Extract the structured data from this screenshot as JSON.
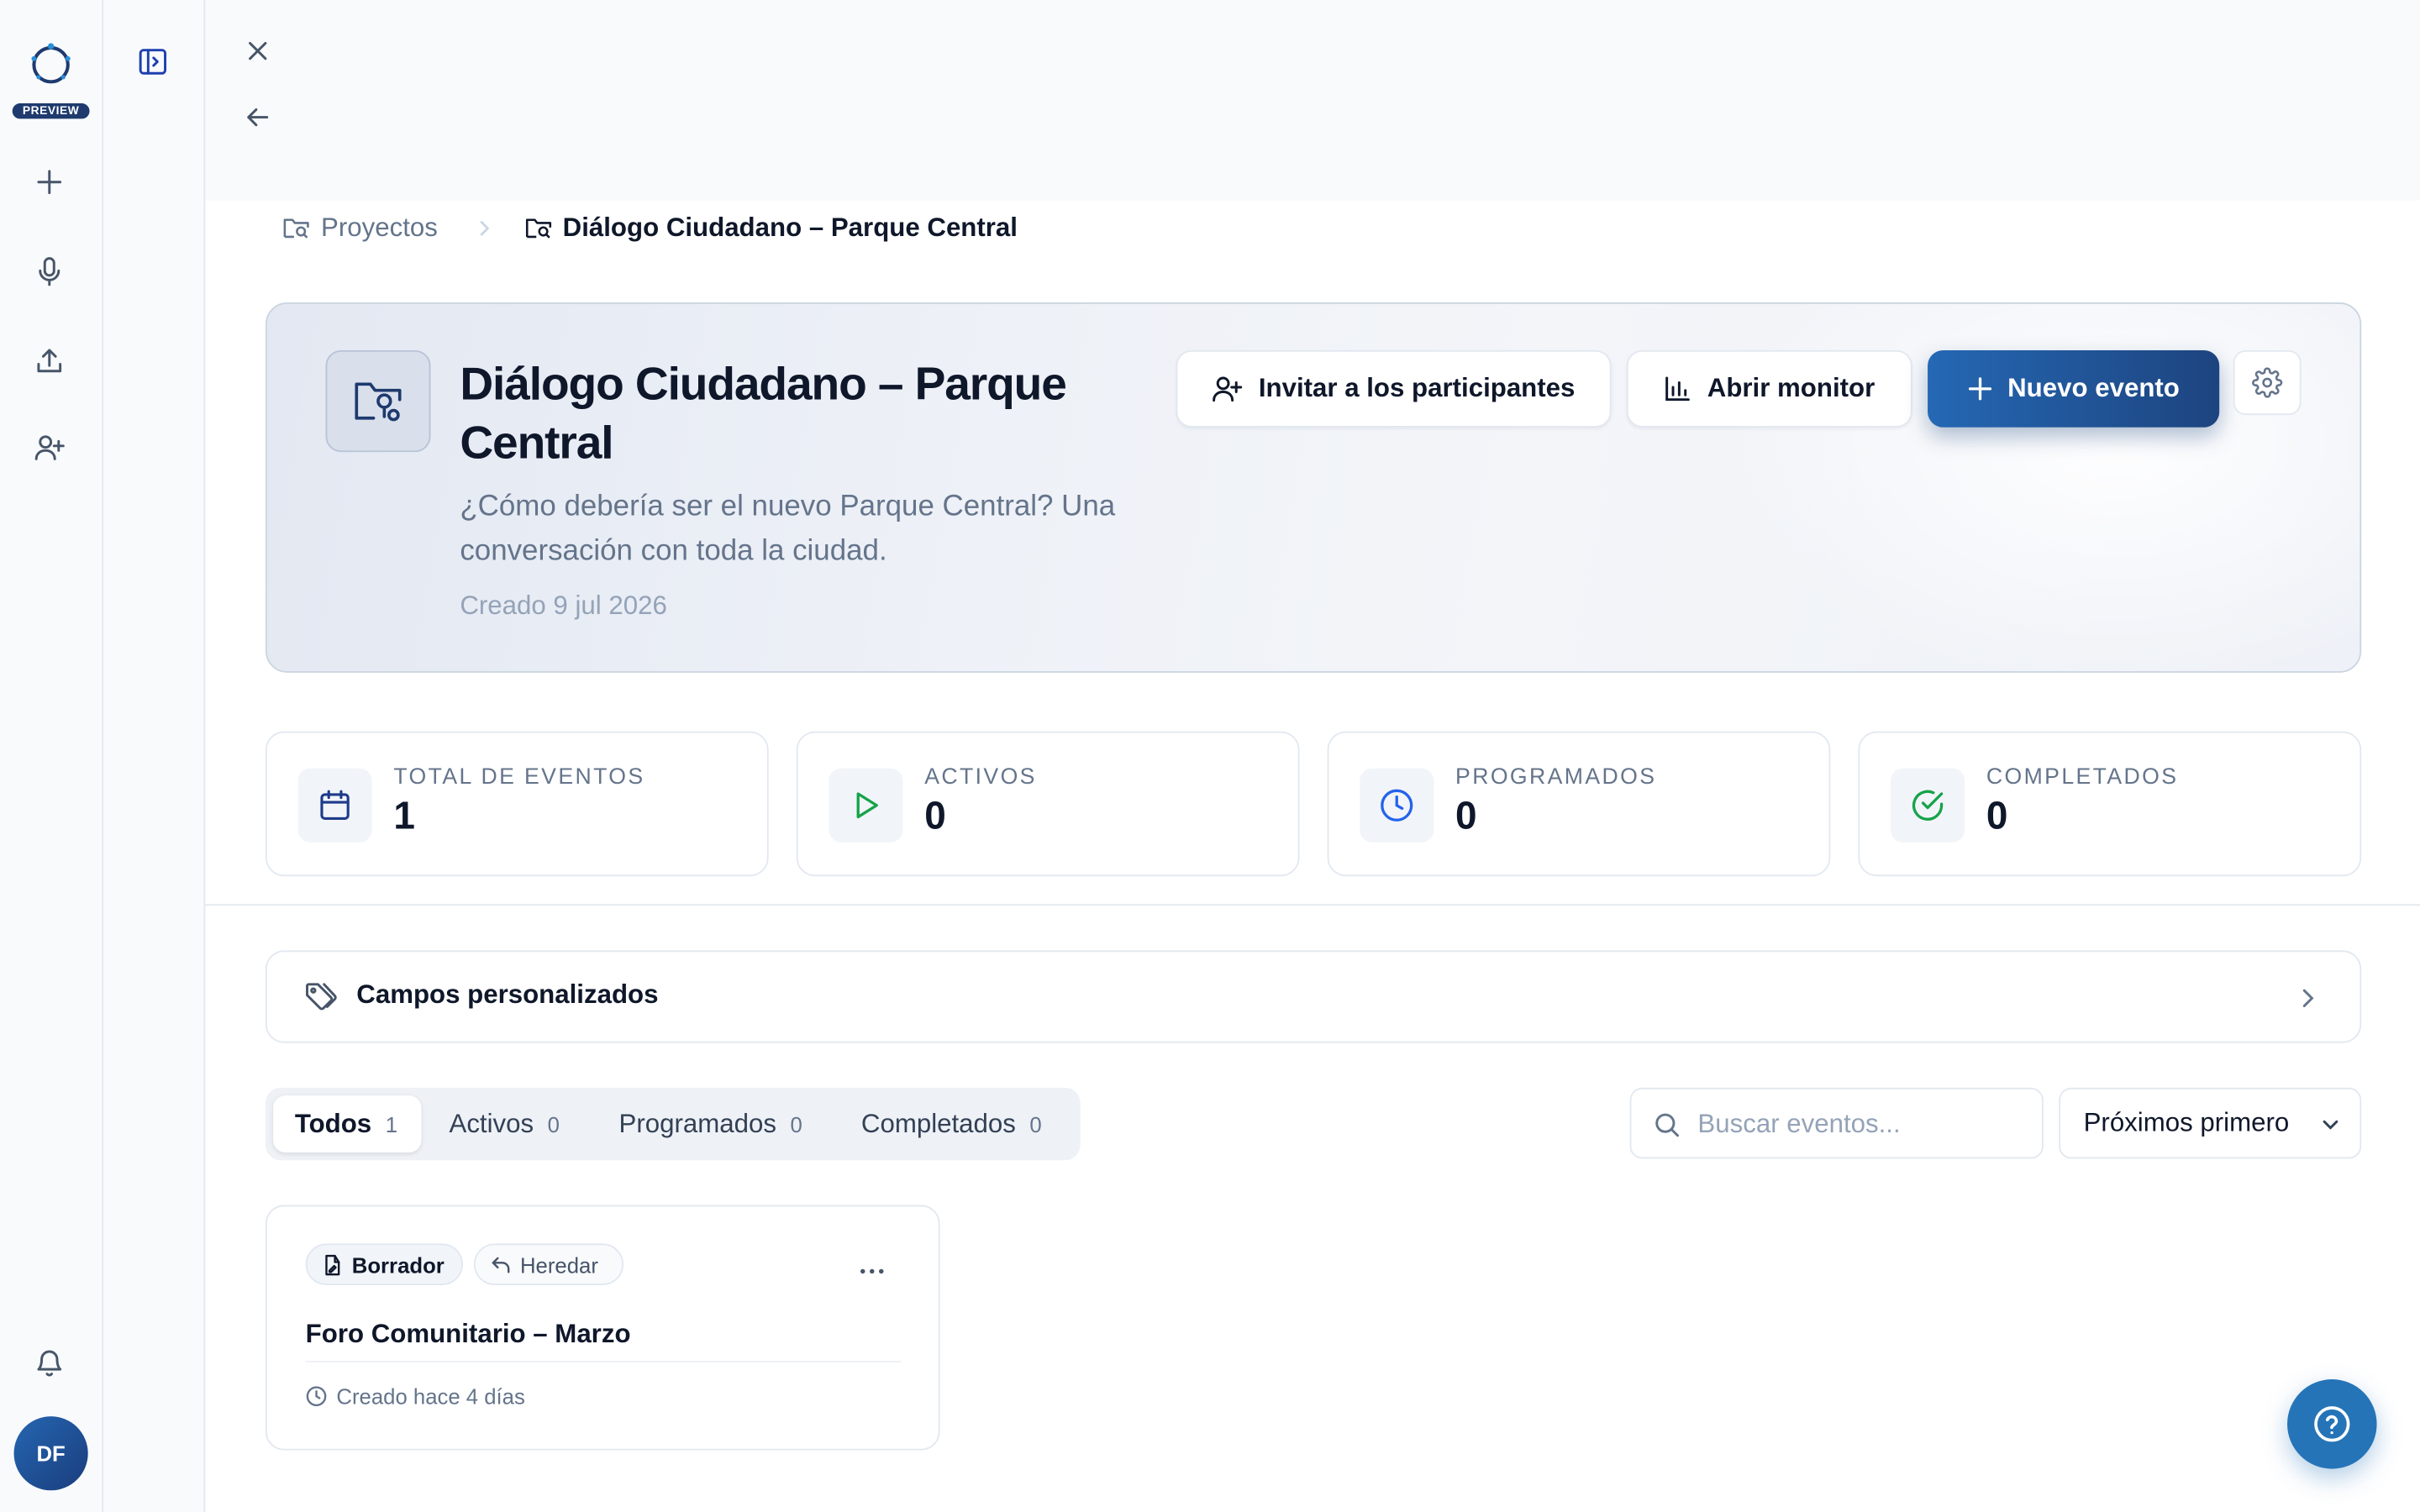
{
  "sidebar": {
    "preview_badge": "PREVIEW",
    "items": [
      {
        "name": "new",
        "icon": "plus-icon"
      },
      {
        "name": "record",
        "icon": "microphone-icon"
      },
      {
        "name": "upload",
        "icon": "upload-icon"
      },
      {
        "name": "invite",
        "icon": "user-plus-icon"
      }
    ],
    "notifications_icon": "bell-icon",
    "avatar_initials": "DF"
  },
  "topbar": {
    "close_icon": "close-icon",
    "back_icon": "arrow-left-icon"
  },
  "breadcrumb": {
    "items": [
      "Proyectos",
      "Diálogo Ciudadano – Parque Central"
    ]
  },
  "project": {
    "title": "Diálogo Ciudadano – Parque Central",
    "description": "¿Cómo debería ser el nuevo Parque Central? Una conversación con toda la ciudad.",
    "created": "Creado 9 jul 2026",
    "actions": {
      "invite_label": "Invitar a los participantes",
      "monitor_label": "Abrir monitor",
      "new_event_label": "Nuevo evento"
    }
  },
  "stats": [
    {
      "label": "TOTAL DE EVENTOS",
      "value": "1",
      "icon": "calendar-icon",
      "color": "#1e3a8a"
    },
    {
      "label": "ACTIVOS",
      "value": "0",
      "icon": "play-icon",
      "color": "#16a34a"
    },
    {
      "label": "PROGRAMADOS",
      "value": "0",
      "icon": "clock-icon",
      "color": "#2563eb"
    },
    {
      "label": "COMPLETADOS",
      "value": "0",
      "icon": "check-circle-icon",
      "color": "#16a34a"
    }
  ],
  "custom_fields": {
    "label": "Campos personalizados"
  },
  "tabs": [
    {
      "label": "Todos",
      "count": "1"
    },
    {
      "label": "Activos",
      "count": "0"
    },
    {
      "label": "Programados",
      "count": "0"
    },
    {
      "label": "Completados",
      "count": "0"
    }
  ],
  "search": {
    "placeholder": "Buscar eventos...",
    "value": ""
  },
  "sort": {
    "selected": "Próximos primero"
  },
  "events": [
    {
      "status": "Borrador",
      "mode": "Heredar",
      "title": "Foro Comunitario – Marzo",
      "created": "Creado hace 4 días"
    }
  ],
  "colors": {
    "accent": "#1d447f",
    "accent_light": "#2568b4",
    "help": "#2574b8"
  }
}
